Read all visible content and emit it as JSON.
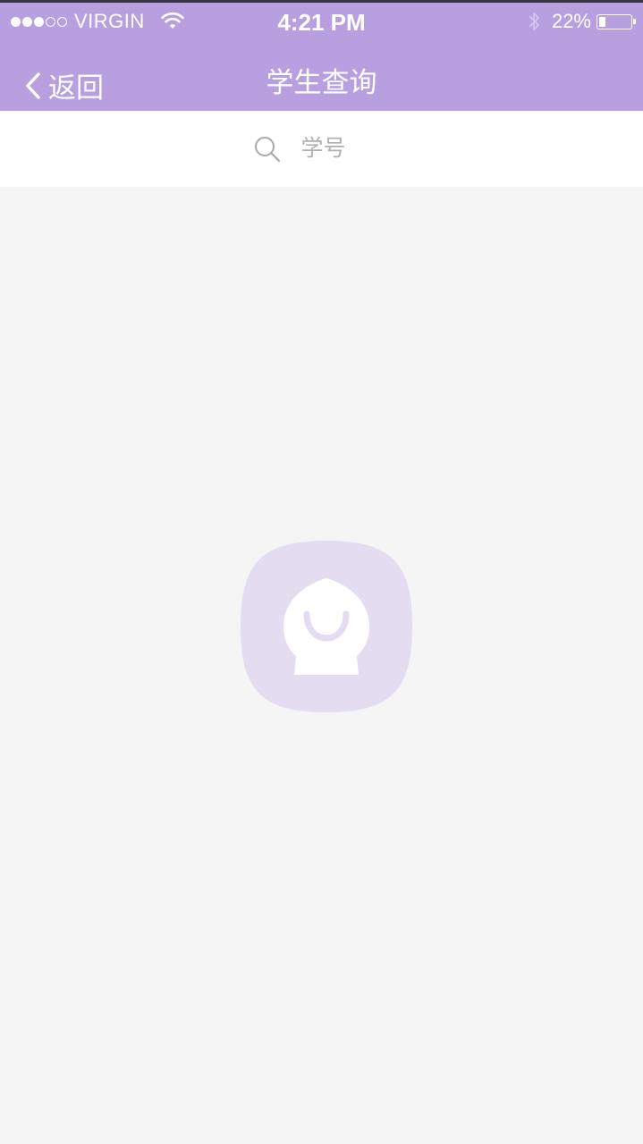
{
  "status_bar": {
    "carrier": "VIRGIN",
    "signal_bars_filled": 3,
    "signal_bars_total": 5,
    "time": "4:21 PM",
    "battery_percent_text": "22%",
    "battery_level": 0.22
  },
  "nav": {
    "back_label": "返回",
    "title": "学生查询"
  },
  "search": {
    "placeholder": "学号",
    "value": ""
  },
  "colors": {
    "header_bg": "#b79fe0",
    "page_bg": "#f5f5f5",
    "empty_icon_bg": "#e4dcf0"
  },
  "icons": {
    "back": "chevron-left-icon",
    "search": "search-icon",
    "empty_state": "empty-state-mascot-icon",
    "wifi": "wifi-icon",
    "bluetooth": "bluetooth-icon",
    "battery": "battery-icon"
  }
}
